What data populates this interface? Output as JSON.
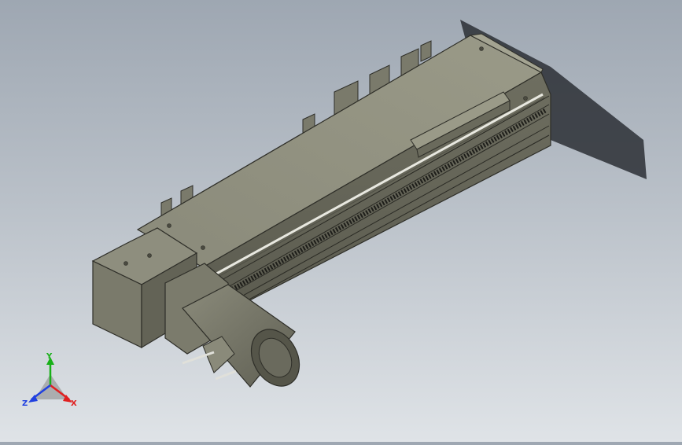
{
  "viewport": {
    "background_top": "#9ea7b2",
    "background_bottom": "#dfe3e7",
    "model_color": "#7e7e6e",
    "shadow_color": "#2b2f35"
  },
  "triad": {
    "x_label": "X",
    "y_label": "Y",
    "z_label": "Z",
    "x_color": "#e02020",
    "y_color": "#18b018",
    "z_color": "#2040e0"
  }
}
